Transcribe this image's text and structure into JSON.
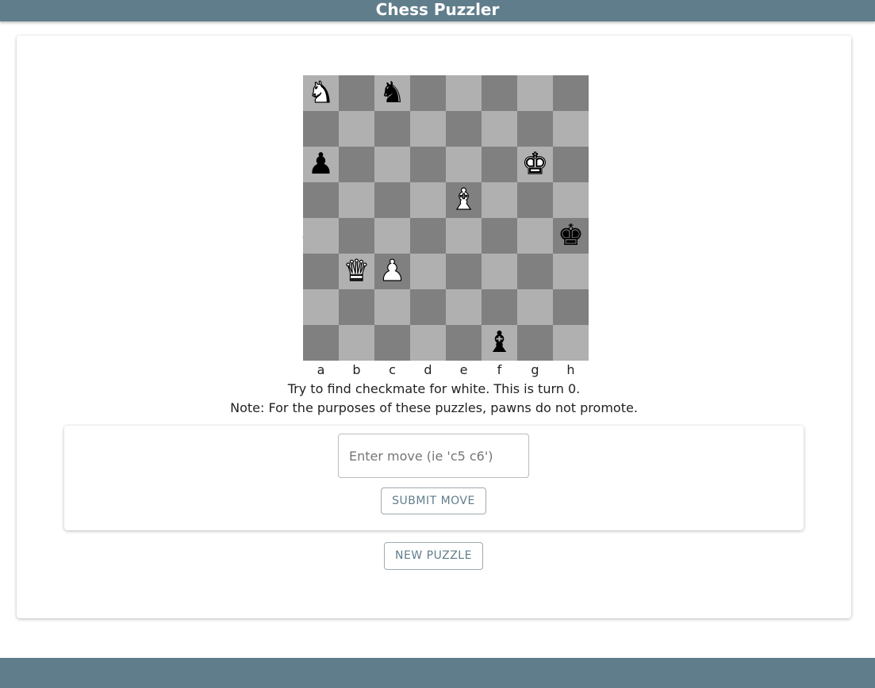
{
  "header": {
    "title": "Chess Puzzler"
  },
  "board": {
    "ranks": [
      "8",
      "7",
      "6",
      "5",
      "4",
      "3",
      "2",
      "1"
    ],
    "files": [
      "a",
      "b",
      "c",
      "d",
      "e",
      "f",
      "g",
      "h"
    ],
    "light_color": "#b0b0b0",
    "dark_color": "#808080",
    "pieces": [
      {
        "square": "a8",
        "color": "white",
        "type": "knight",
        "glyph": "♞"
      },
      {
        "square": "c8",
        "color": "black",
        "type": "knight",
        "glyph": "♞"
      },
      {
        "square": "a6",
        "color": "black",
        "type": "pawn",
        "glyph": "♟"
      },
      {
        "square": "g6",
        "color": "white",
        "type": "king",
        "glyph": "♚"
      },
      {
        "square": "e5",
        "color": "white",
        "type": "bishop",
        "glyph": "♝"
      },
      {
        "square": "h4",
        "color": "black",
        "type": "king",
        "glyph": "♚"
      },
      {
        "square": "b3",
        "color": "white",
        "type": "queen",
        "glyph": "♛"
      },
      {
        "square": "c3",
        "color": "white",
        "type": "pawn",
        "glyph": "♟"
      },
      {
        "square": "f1",
        "color": "black",
        "type": "bishop",
        "glyph": "♝"
      }
    ]
  },
  "puzzle": {
    "instruction": "Try to find checkmate for white. This is turn 0.",
    "note": "Note: For the purposes of these puzzles, pawns do not promote."
  },
  "move_form": {
    "input_value": "",
    "input_placeholder": "Enter move (ie 'c5 c6')",
    "submit_label": "SUBMIT MOVE"
  },
  "actions": {
    "new_puzzle_label": "NEW PUZZLE"
  },
  "colors": {
    "accent": "#607d8b"
  }
}
